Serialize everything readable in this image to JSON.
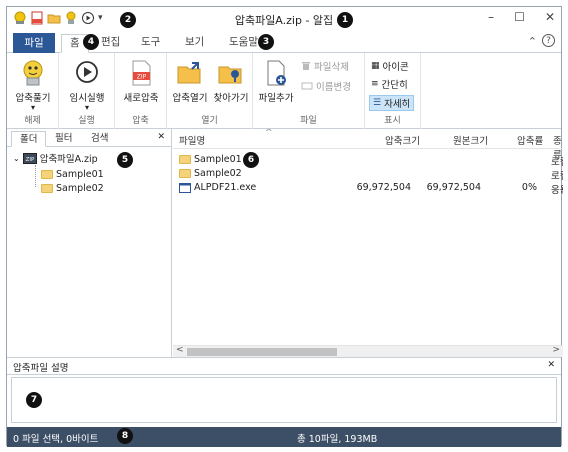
{
  "window": {
    "title": "압축파일A.zip - 알집",
    "minimize": "–",
    "maximize": "☐",
    "close": "✕",
    "quick_access_more": "▾"
  },
  "tabs": [
    {
      "label": "파일"
    },
    {
      "label": "홈"
    },
    {
      "label": "편집"
    },
    {
      "label": "도구"
    },
    {
      "label": "보기"
    },
    {
      "label": "도움말"
    }
  ],
  "ribbon_right_icons": {
    "collapse": "⌃",
    "help": "?"
  },
  "ribbon": {
    "groups": {
      "release": {
        "name": "해제",
        "button": "압축풀기",
        "dropdown": "▾"
      },
      "run": {
        "name": "실행",
        "button": "임시실행",
        "dropdown": "▾"
      },
      "compress": {
        "name": "압축",
        "button": "새로압축",
        "zip_text": "ZIP"
      },
      "open": {
        "name": "열기",
        "open_button": "압축열기",
        "find_button": "찾아가기"
      },
      "file": {
        "name": "파일",
        "add_button": "파일추가",
        "delete_button": "파일삭제",
        "rename_button": "이름변경"
      },
      "view": {
        "name": "표시",
        "icon_view": "아이콘",
        "simple_view": "간단히",
        "detail_view": "자세히"
      }
    }
  },
  "left_panel": {
    "tabs": [
      "폴더",
      "필터",
      "검색"
    ],
    "close": "✕",
    "tree": [
      {
        "label": "압축파일A.zip",
        "level": 0,
        "zip_text": "ZIP"
      },
      {
        "label": "Sample01",
        "level": 1
      },
      {
        "label": "Sample02",
        "level": 1
      }
    ]
  },
  "file_list": {
    "sort_indicator": "^",
    "columns": [
      "파일명",
      "압축크기",
      "원본크기",
      "압축률",
      "종류"
    ],
    "rows": [
      {
        "name": "Sample01",
        "icon": "folder-icon",
        "packed": "",
        "original": "",
        "ratio": "",
        "type": "로컬"
      },
      {
        "name": "Sample02",
        "icon": "folder-icon",
        "packed": "",
        "original": "",
        "ratio": "",
        "type": "로컬"
      },
      {
        "name": "ALPDF21.exe",
        "icon": "exe-icon",
        "packed": "69,972,504",
        "original": "69,972,504",
        "ratio": "0%",
        "type": "응용"
      }
    ],
    "scroll_left": "<",
    "scroll_right": ">"
  },
  "description": {
    "title": "압축파일 설명",
    "close": "✕",
    "text": ""
  },
  "status": {
    "left": "0 파일 선택, 0바이트",
    "right": "총 10파일, 193MB"
  },
  "markers": [
    "1",
    "2",
    "3",
    "4",
    "5",
    "6",
    "7",
    "8"
  ],
  "colors": {
    "accent": "#2b5797",
    "status_bg": "#3d4f66",
    "folder": "#f5d37a"
  }
}
